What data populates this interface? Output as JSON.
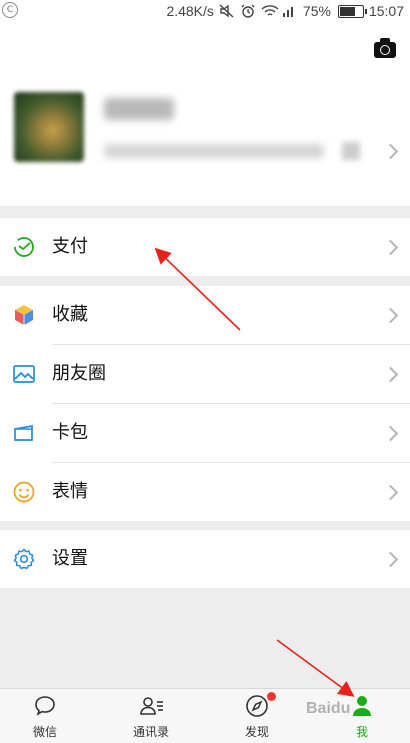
{
  "status_bar": {
    "speed": "2.48K/s",
    "battery": "75%",
    "battery_level": 0.75,
    "time": "15:07",
    "left_icon": "notification-c-icon"
  },
  "header": {
    "camera_icon": "camera-icon"
  },
  "profile": {
    "avatar": "blurred",
    "name": "",
    "id": ""
  },
  "menu": {
    "pay": {
      "label": "支付",
      "icon": "wechat-pay-icon",
      "color": "#1aad19"
    },
    "favorites": {
      "label": "收藏",
      "icon": "favorites-cube-icon"
    },
    "moments": {
      "label": "朋友圈",
      "icon": "moments-image-icon",
      "color": "#2a8bd8"
    },
    "cards": {
      "label": "卡包",
      "icon": "card-wallet-icon",
      "color": "#2a8bd8"
    },
    "stickers": {
      "label": "表情",
      "icon": "sticker-smile-icon",
      "color": "#f0a21e"
    },
    "settings": {
      "label": "设置",
      "icon": "settings-gear-icon",
      "color": "#2a8bd8"
    }
  },
  "tabbar": {
    "chats": "微信",
    "contacts": "通讯录",
    "discover": "发现",
    "me": "我",
    "active": "me",
    "active_color": "#1aad19"
  },
  "watermark": "Baidu"
}
